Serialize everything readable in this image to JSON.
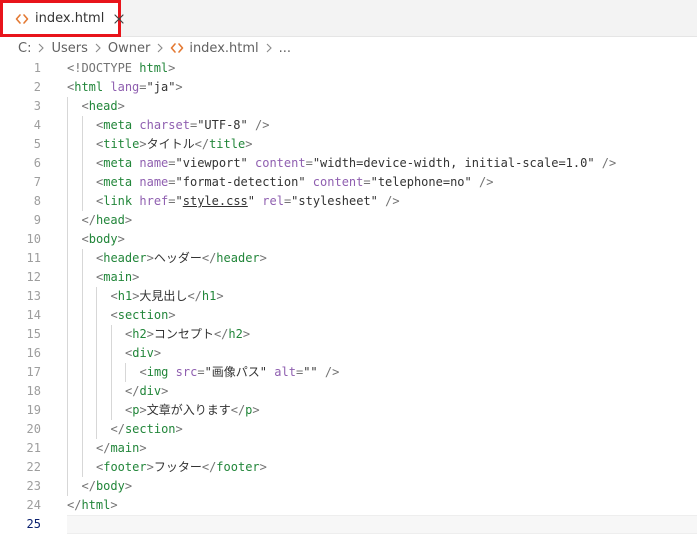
{
  "tab": {
    "label": "index.html",
    "icon": "html-file-icon",
    "close_icon": "close-icon",
    "highlight_color": "#e8141b"
  },
  "breadcrumb": {
    "items": [
      "C:",
      "Users",
      "Owner",
      "index.html",
      "..."
    ]
  },
  "editor": {
    "current_line": 25,
    "lines": [
      {
        "n": "1",
        "indent": 0,
        "tokens": [
          [
            "br",
            "<!DOCTYPE "
          ],
          [
            "tag",
            "html"
          ],
          [
            "br",
            ">"
          ]
        ]
      },
      {
        "n": "2",
        "indent": 0,
        "tokens": [
          [
            "br",
            "<"
          ],
          [
            "tag",
            "html"
          ],
          [
            "text",
            " "
          ],
          [
            "attr",
            "lang"
          ],
          [
            "br",
            "="
          ],
          [
            "str",
            "\"ja\""
          ],
          [
            "br",
            ">"
          ]
        ]
      },
      {
        "n": "3",
        "indent": 1,
        "tokens": [
          [
            "br",
            "<"
          ],
          [
            "tag",
            "head"
          ],
          [
            "br",
            ">"
          ]
        ]
      },
      {
        "n": "4",
        "indent": 2,
        "tokens": [
          [
            "br",
            "<"
          ],
          [
            "tag",
            "meta"
          ],
          [
            "text",
            " "
          ],
          [
            "attr",
            "charset"
          ],
          [
            "br",
            "="
          ],
          [
            "str",
            "\"UTF-8\""
          ],
          [
            "br",
            " />"
          ]
        ]
      },
      {
        "n": "5",
        "indent": 2,
        "tokens": [
          [
            "br",
            "<"
          ],
          [
            "tag",
            "title"
          ],
          [
            "br",
            ">"
          ],
          [
            "text",
            "タイトル"
          ],
          [
            "br",
            "</"
          ],
          [
            "tag",
            "title"
          ],
          [
            "br",
            ">"
          ]
        ]
      },
      {
        "n": "6",
        "indent": 2,
        "tokens": [
          [
            "br",
            "<"
          ],
          [
            "tag",
            "meta"
          ],
          [
            "text",
            " "
          ],
          [
            "attr",
            "name"
          ],
          [
            "br",
            "="
          ],
          [
            "str",
            "\"viewport\""
          ],
          [
            "text",
            " "
          ],
          [
            "attr",
            "content"
          ],
          [
            "br",
            "="
          ],
          [
            "str",
            "\"width=device-width, initial-scale=1.0\""
          ],
          [
            "br",
            " />"
          ]
        ]
      },
      {
        "n": "7",
        "indent": 2,
        "tokens": [
          [
            "br",
            "<"
          ],
          [
            "tag",
            "meta"
          ],
          [
            "text",
            " "
          ],
          [
            "attr",
            "name"
          ],
          [
            "br",
            "="
          ],
          [
            "str",
            "\"format-detection\""
          ],
          [
            "text",
            " "
          ],
          [
            "attr",
            "content"
          ],
          [
            "br",
            "="
          ],
          [
            "str",
            "\"telephone=no\""
          ],
          [
            "br",
            " />"
          ]
        ]
      },
      {
        "n": "8",
        "indent": 2,
        "tokens": [
          [
            "br",
            "<"
          ],
          [
            "tag",
            "link"
          ],
          [
            "text",
            " "
          ],
          [
            "attr",
            "href"
          ],
          [
            "br",
            "="
          ],
          [
            "str",
            "\""
          ],
          [
            "link",
            "style.css"
          ],
          [
            "str",
            "\""
          ],
          [
            "text",
            " "
          ],
          [
            "attr",
            "rel"
          ],
          [
            "br",
            "="
          ],
          [
            "str",
            "\"stylesheet\""
          ],
          [
            "br",
            " />"
          ]
        ]
      },
      {
        "n": "9",
        "indent": 1,
        "tokens": [
          [
            "br",
            "</"
          ],
          [
            "tag",
            "head"
          ],
          [
            "br",
            ">"
          ]
        ]
      },
      {
        "n": "10",
        "indent": 1,
        "tokens": [
          [
            "br",
            "<"
          ],
          [
            "tag",
            "body"
          ],
          [
            "br",
            ">"
          ]
        ]
      },
      {
        "n": "11",
        "indent": 2,
        "tokens": [
          [
            "br",
            "<"
          ],
          [
            "tag",
            "header"
          ],
          [
            "br",
            ">"
          ],
          [
            "text",
            "ヘッダー"
          ],
          [
            "br",
            "</"
          ],
          [
            "tag",
            "header"
          ],
          [
            "br",
            ">"
          ]
        ]
      },
      {
        "n": "12",
        "indent": 2,
        "tokens": [
          [
            "br",
            "<"
          ],
          [
            "tag",
            "main"
          ],
          [
            "br",
            ">"
          ]
        ]
      },
      {
        "n": "13",
        "indent": 3,
        "tokens": [
          [
            "br",
            "<"
          ],
          [
            "tag",
            "h1"
          ],
          [
            "br",
            ">"
          ],
          [
            "text",
            "大見出し"
          ],
          [
            "br",
            "</"
          ],
          [
            "tag",
            "h1"
          ],
          [
            "br",
            ">"
          ]
        ]
      },
      {
        "n": "14",
        "indent": 3,
        "tokens": [
          [
            "br",
            "<"
          ],
          [
            "tag",
            "section"
          ],
          [
            "br",
            ">"
          ]
        ]
      },
      {
        "n": "15",
        "indent": 4,
        "tokens": [
          [
            "br",
            "<"
          ],
          [
            "tag",
            "h2"
          ],
          [
            "br",
            ">"
          ],
          [
            "text",
            "コンセプト"
          ],
          [
            "br",
            "</"
          ],
          [
            "tag",
            "h2"
          ],
          [
            "br",
            ">"
          ]
        ]
      },
      {
        "n": "16",
        "indent": 4,
        "tokens": [
          [
            "br",
            "<"
          ],
          [
            "tag",
            "div"
          ],
          [
            "br",
            ">"
          ]
        ]
      },
      {
        "n": "17",
        "indent": 5,
        "tokens": [
          [
            "br",
            "<"
          ],
          [
            "tag",
            "img"
          ],
          [
            "text",
            " "
          ],
          [
            "attr",
            "src"
          ],
          [
            "br",
            "="
          ],
          [
            "str",
            "\"画像パス\""
          ],
          [
            "text",
            " "
          ],
          [
            "attr",
            "alt"
          ],
          [
            "br",
            "="
          ],
          [
            "str",
            "\"\""
          ],
          [
            "br",
            " />"
          ]
        ]
      },
      {
        "n": "18",
        "indent": 4,
        "tokens": [
          [
            "br",
            "</"
          ],
          [
            "tag",
            "div"
          ],
          [
            "br",
            ">"
          ]
        ]
      },
      {
        "n": "19",
        "indent": 4,
        "tokens": [
          [
            "br",
            "<"
          ],
          [
            "tag",
            "p"
          ],
          [
            "br",
            ">"
          ],
          [
            "text",
            "文章が入ります"
          ],
          [
            "br",
            "</"
          ],
          [
            "tag",
            "p"
          ],
          [
            "br",
            ">"
          ]
        ]
      },
      {
        "n": "20",
        "indent": 3,
        "tokens": [
          [
            "br",
            "</"
          ],
          [
            "tag",
            "section"
          ],
          [
            "br",
            ">"
          ]
        ]
      },
      {
        "n": "21",
        "indent": 2,
        "tokens": [
          [
            "br",
            "</"
          ],
          [
            "tag",
            "main"
          ],
          [
            "br",
            ">"
          ]
        ]
      },
      {
        "n": "22",
        "indent": 2,
        "tokens": [
          [
            "br",
            "<"
          ],
          [
            "tag",
            "footer"
          ],
          [
            "br",
            ">"
          ],
          [
            "text",
            "フッター"
          ],
          [
            "br",
            "</"
          ],
          [
            "tag",
            "footer"
          ],
          [
            "br",
            ">"
          ]
        ]
      },
      {
        "n": "23",
        "indent": 1,
        "tokens": [
          [
            "br",
            "</"
          ],
          [
            "tag",
            "body"
          ],
          [
            "br",
            ">"
          ]
        ]
      },
      {
        "n": "24",
        "indent": 0,
        "tokens": [
          [
            "br",
            "</"
          ],
          [
            "tag",
            "html"
          ],
          [
            "br",
            ">"
          ]
        ]
      },
      {
        "n": "25",
        "indent": 0,
        "tokens": []
      }
    ]
  }
}
